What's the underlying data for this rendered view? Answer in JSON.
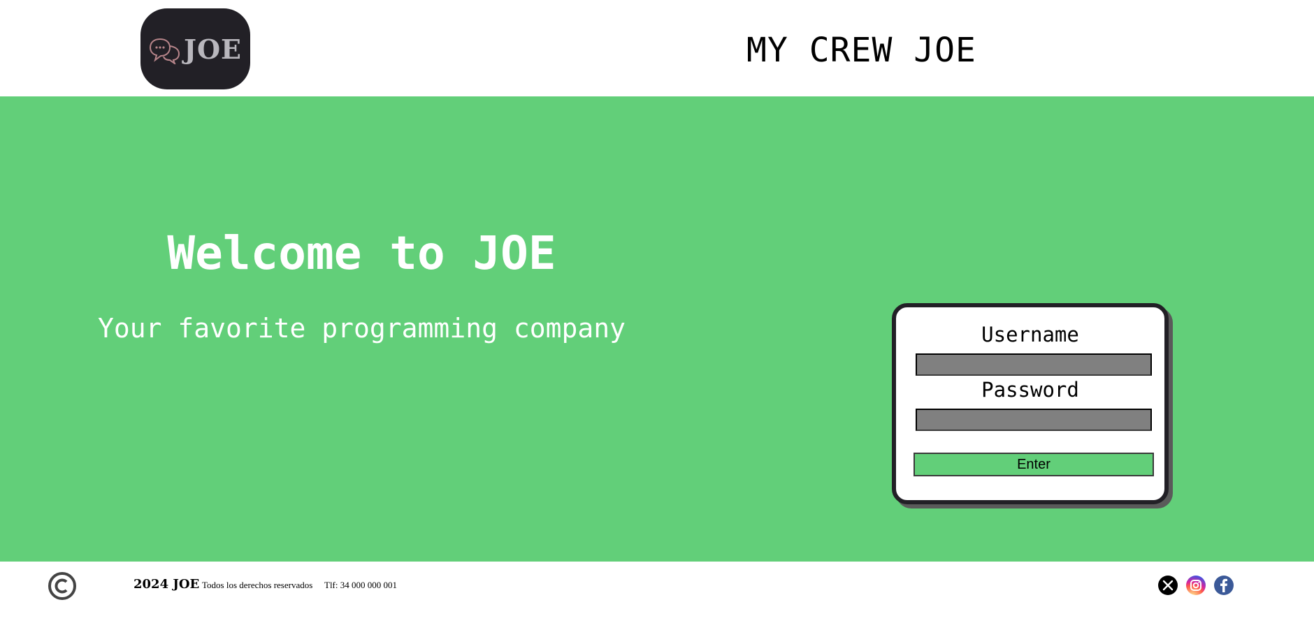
{
  "header": {
    "logo_text": "JOE",
    "title": "MY CREW JOE"
  },
  "hero": {
    "welcome": "Welcome to JOE",
    "tagline": "Your favorite programming company"
  },
  "login": {
    "username_label": "Username",
    "username_value": "",
    "password_label": "Password",
    "password_value": "",
    "enter_label": "Enter"
  },
  "footer": {
    "brand": "2024 JOE",
    "rights": "Todos los derechos reservados",
    "phone": "Tlf: 34 000 000 001",
    "social": [
      "x-icon",
      "instagram-icon",
      "facebook-icon"
    ]
  },
  "colors": {
    "accent_green": "#62cf79",
    "logo_bg": "#222026",
    "input_gray": "#808080"
  }
}
